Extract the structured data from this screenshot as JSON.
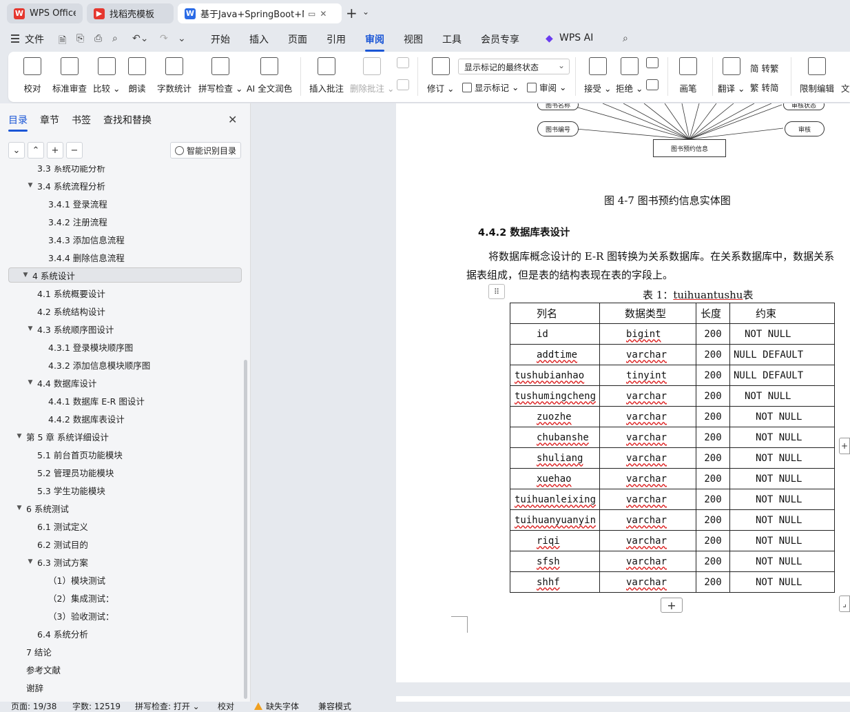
{
  "tabs": [
    {
      "label": "WPS Office",
      "icon": "wps-logo-icon",
      "color": "#e5372f"
    },
    {
      "label": "找稻壳模板",
      "icon": "docer-icon",
      "color": "#e5372f"
    },
    {
      "label": "基于Java+SpringBoot+MyS",
      "icon": "word-doc-icon",
      "color": "#2b6be6"
    }
  ],
  "menu": {
    "file": "文件",
    "items": [
      "开始",
      "插入",
      "页面",
      "引用",
      "审阅",
      "视图",
      "工具",
      "会员专享"
    ],
    "active": "审阅",
    "ai": "WPS AI"
  },
  "ribbon": {
    "proofread": "校对",
    "std_review": "标准审查",
    "compare": "比较",
    "read_aloud": "朗读",
    "word_count": "字数统计",
    "spell_check": "拼写检查",
    "ai_polish": "AI 全文润色",
    "insert_comment": "插入批注",
    "delete_comment": "删除批注",
    "track_changes": "修订",
    "markup_display": "显示标记的最终状态",
    "show_markup": "显示标记",
    "review": "审阅",
    "accept": "接受",
    "reject": "拒绝",
    "pen": "画笔",
    "translate": "翻译",
    "to_trad": "简 转繁",
    "to_simp": "繁 转简",
    "restrict_edit": "限制编辑",
    "more": "文"
  },
  "nav": {
    "tabs": [
      "目录",
      "章节",
      "书签",
      "查找和替换"
    ],
    "smart_btn": "智能识别目录",
    "toc": [
      {
        "text": "3.3  系统功能分析",
        "level": 2,
        "toggle": ""
      },
      {
        "text": "3.4 系统流程分析",
        "level": 2,
        "toggle": "▼"
      },
      {
        "text": "3.4.1 登录流程",
        "level": 3,
        "toggle": ""
      },
      {
        "text": "3.4.2 注册流程",
        "level": 3,
        "toggle": ""
      },
      {
        "text": "3.4.3 添加信息流程",
        "level": 3,
        "toggle": ""
      },
      {
        "text": "3.4.4 删除信息流程",
        "level": 3,
        "toggle": ""
      },
      {
        "text": "4   系统设计",
        "level": 1,
        "toggle": "▼",
        "selected": true
      },
      {
        "text": "4.1 系统概要设计",
        "level": 2,
        "toggle": ""
      },
      {
        "text": "4.2 系统结构设计",
        "level": 2,
        "toggle": ""
      },
      {
        "text": "4.3 系统顺序图设计",
        "level": 2,
        "toggle": "▼"
      },
      {
        "text": "4.3.1 登录模块顺序图",
        "level": 3,
        "toggle": ""
      },
      {
        "text": "4.3.2 添加信息模块顺序图",
        "level": 3,
        "toggle": ""
      },
      {
        "text": "4.4 数据库设计",
        "level": 2,
        "toggle": "▼"
      },
      {
        "text": "4.4.1 数据库 E-R 图设计",
        "level": 3,
        "toggle": ""
      },
      {
        "text": "4.4.2 数据库表设计",
        "level": 3,
        "toggle": ""
      },
      {
        "text": "第 5 章  系统详细设计",
        "level": 1,
        "toggle": "▼"
      },
      {
        "text": "5.1 前台首页功能模块",
        "level": 2,
        "toggle": ""
      },
      {
        "text": "5.2 管理员功能模块",
        "level": 2,
        "toggle": ""
      },
      {
        "text": "5.3 学生功能模块",
        "level": 2,
        "toggle": ""
      },
      {
        "text": "6  系统测试",
        "level": 1,
        "toggle": "▼"
      },
      {
        "text": "6.1  测试定义",
        "level": 2,
        "toggle": ""
      },
      {
        "text": "6.2  测试目的",
        "level": 2,
        "toggle": ""
      },
      {
        "text": "6.3 测试方案",
        "level": 2,
        "toggle": "▼"
      },
      {
        "text": "（1）模块测试",
        "level": 3,
        "toggle": ""
      },
      {
        "text": "（2）集成测试：",
        "level": 3,
        "toggle": ""
      },
      {
        "text": "（3）验收测试：",
        "level": 3,
        "toggle": ""
      },
      {
        "text": "6.4 系统分析",
        "level": 2,
        "toggle": ""
      },
      {
        "text": "7  结论",
        "level": 1,
        "toggle": ""
      },
      {
        "text": "参考文献",
        "level": 1,
        "toggle": ""
      },
      {
        "text": "谢辞",
        "level": 1,
        "toggle": ""
      }
    ]
  },
  "doc": {
    "er_nodes": {
      "book_name": "图书名称",
      "book_no": "图书编号",
      "audit_status": "审核状态",
      "audit": "审核",
      "entity": "图书预约信息"
    },
    "figure_caption": "图 4-7  图书预约信息实体图",
    "section_heading": "4.4.2 数据库表设计",
    "para_line1": "将数据库概念设计的 E-R 图转换为关系数据库。在关系数据库中，数据关系",
    "para_line2": "据表组成，但是表的结构表现在表的字段上。",
    "table_caption_prefix": "表 1：",
    "table_caption_name": "tuihuantushu",
    "table_caption_suffix": "表",
    "table_header": [
      "列名",
      "数据类型",
      "长度",
      "约束"
    ],
    "table_rows": [
      [
        "id",
        "bigint",
        "200",
        "NOT NULL"
      ],
      [
        "addtime",
        "varchar",
        "200",
        "NULL DEFAULT"
      ],
      [
        "tushubianhao",
        "tinyint",
        "200",
        "NULL DEFAULT"
      ],
      [
        "tushumingcheng",
        "varchar",
        "200",
        "NOT NULL"
      ],
      [
        "zuozhe",
        "varchar",
        "200",
        "NOT NULL"
      ],
      [
        "chubanshe",
        "varchar",
        "200",
        "NOT NULL"
      ],
      [
        "shuliang",
        "varchar",
        "200",
        "NOT NULL"
      ],
      [
        "xuehao",
        "varchar",
        "200",
        "NOT NULL"
      ],
      [
        "tuihuanleixing",
        "varchar",
        "200",
        "NOT NULL"
      ],
      [
        "tuihuanyuanyin",
        "varchar",
        "200",
        "NOT NULL"
      ],
      [
        "riqi",
        "varchar",
        "200",
        "NOT NULL"
      ],
      [
        "sfsh",
        "varchar",
        "200",
        "NOT NULL"
      ],
      [
        "shhf",
        "varchar",
        "200",
        "NOT NULL"
      ]
    ]
  },
  "status": {
    "page": "页面: 19/38",
    "words": "字数: 12519",
    "spell": "拼写检查: 打开 ⌄",
    "proof": "校对",
    "missing_font": "缺失字体",
    "compat": "兼容模式"
  },
  "colors": {
    "accent": "#1a56d6",
    "warning": "#f0a020",
    "spell_underline": "#d22222"
  }
}
